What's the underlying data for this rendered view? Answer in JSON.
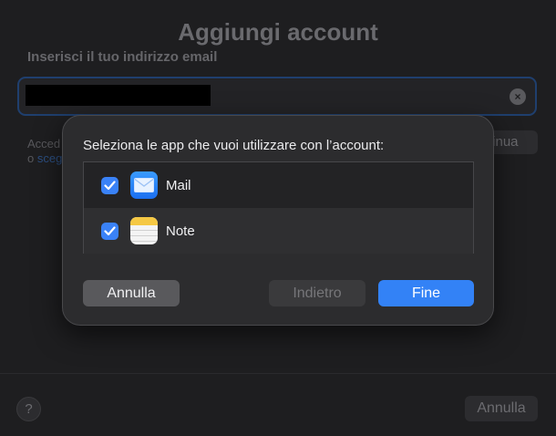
{
  "background": {
    "title": "Aggiungi account",
    "email_label": "Inserisci il tuo indirizzo email",
    "side_text_line1": "Acced",
    "side_text_line2_prefix": "o",
    "side_text_line2_link": "sceg",
    "continue_button": "tinua",
    "help_button": "?",
    "cancel_button": "Annulla"
  },
  "sheet": {
    "title": "Seleziona le app che vuoi utilizzare con l’account:",
    "apps": [
      {
        "name": "Mail",
        "checked": true,
        "icon": "mail-icon"
      },
      {
        "name": "Note",
        "checked": true,
        "icon": "notes-icon"
      }
    ],
    "buttons": {
      "cancel": "Annulla",
      "back": "Indietro",
      "done": "Fine"
    }
  },
  "colors": {
    "accent": "#3382f6",
    "checkbox": "#3a82f7"
  }
}
